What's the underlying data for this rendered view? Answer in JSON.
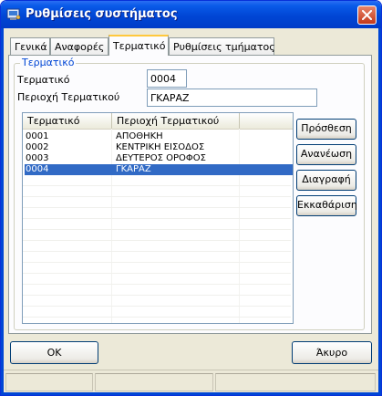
{
  "window": {
    "title": "Ρυθμίσεις συστήματος",
    "icon": "app-window-icon"
  },
  "tabs": [
    {
      "label": "Γενικά",
      "active": false
    },
    {
      "label": "Αναφορές",
      "active": false
    },
    {
      "label": "Τερματικό",
      "active": true
    },
    {
      "label": "Ρυθμίσεις τμήματος",
      "active": false
    }
  ],
  "group": {
    "legend": "Τερματικό"
  },
  "form": {
    "terminal_label": "Τερματικό",
    "terminal_value": "0004",
    "area_label": "Περιοχή Τερματικού",
    "area_value": "ΓΚΑΡΑΖ"
  },
  "list": {
    "columns": [
      "Τερματικό",
      "Περιοχή Τερματικού"
    ],
    "rows": [
      {
        "code": "0001",
        "area": "ΑΠΟΘΗΚΗ",
        "selected": false
      },
      {
        "code": "0002",
        "area": "ΚΕΝΤΡΙΚΗ ΕΙΣΟΔΟΣ",
        "selected": false
      },
      {
        "code": "0003",
        "area": "ΔΕΥΤΕΡΟΣ ΟΡΟΦΟΣ",
        "selected": false
      },
      {
        "code": "0004",
        "area": "ΓΚΑΡΑΖ",
        "selected": true
      }
    ]
  },
  "actions": {
    "add": "Πρόσθεση",
    "refresh": "Ανανέωση",
    "delete": "Διαγραφή",
    "clear": "Εκκαθάριση"
  },
  "footer": {
    "ok": "OK",
    "cancel": "Άκυρο"
  },
  "colors": {
    "title_bar": "#0046d5",
    "selection": "#316ac5",
    "group_legend": "#0046d5"
  }
}
